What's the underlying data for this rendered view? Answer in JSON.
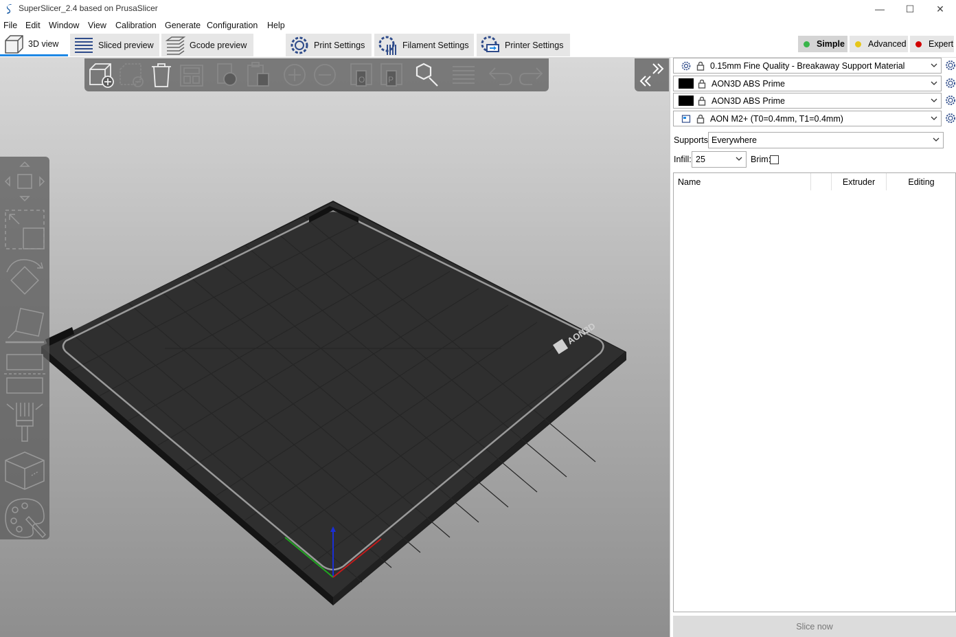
{
  "window": {
    "title": "SuperSlicer_2.4  based on PrusaSlicer",
    "minimize": "—",
    "maximize": "☐",
    "close": "✕"
  },
  "menu": [
    "File",
    "Edit",
    "Window",
    "View",
    "Calibration",
    "Generate",
    "Configuration",
    "Help"
  ],
  "tabs": {
    "view3d": "3D view",
    "sliced": "Sliced preview",
    "gcode": "Gcode preview",
    "print": "Print Settings",
    "filament": "Filament Settings",
    "printer": "Printer Settings"
  },
  "modes": {
    "simple": "Simple",
    "advanced": "Advanced",
    "expert": "Expert",
    "simple_color": "#39b54a",
    "advanced_color": "#e6c619",
    "expert_color": "#d10000"
  },
  "presets": {
    "print": "0.15mm Fine Quality - Breakaway Support Material",
    "filament1": "AON3D ABS Prime",
    "filament2": "AON3D ABS Prime",
    "printer": "AON M2+ (T0=0.4mm, T1=0.4mm)"
  },
  "options": {
    "supports_label": "Supports:",
    "supports_value": "Everywhere",
    "infill_label": "Infill:",
    "infill_value": "25",
    "brim_label": "Brim:"
  },
  "object_list": {
    "col_name": "Name",
    "col_extruder": "Extruder",
    "col_editing": "Editing"
  },
  "slice_button": "Slice now",
  "bed_logo": "AON3D",
  "accent": "#1e88e5"
}
